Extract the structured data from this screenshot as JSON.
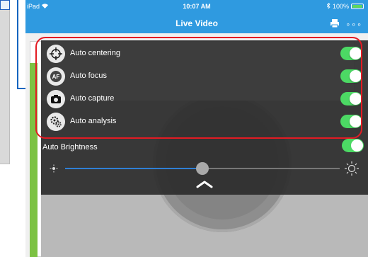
{
  "status_bar": {
    "device": "iPad",
    "wifi_icon": "wifi-icon",
    "time": "10:07 AM",
    "bluetooth_icon": "bluetooth-icon",
    "battery_pct": "100%"
  },
  "nav": {
    "title": "Live Video",
    "print_icon": "print-icon",
    "more_label": "∘∘∘"
  },
  "settings": {
    "items": [
      {
        "label": "Auto centering",
        "icon": "crosshair-icon",
        "enabled": true
      },
      {
        "label": "Auto focus",
        "icon": "af-icon",
        "enabled": true
      },
      {
        "label": "Auto capture",
        "icon": "camera-icon",
        "enabled": true
      },
      {
        "label": "Auto analysis",
        "icon": "gears-icon",
        "enabled": true
      }
    ],
    "auto_brightness": {
      "label": "Auto Brightness",
      "enabled": true
    },
    "brightness": {
      "value": 0.5
    }
  },
  "colors": {
    "nav_blue": "#2f9ae0",
    "toggle_green": "#4cd964",
    "highlight_red": "#e31b23",
    "callout_blue": "#1565c0",
    "strip_green": "#7cc243"
  }
}
